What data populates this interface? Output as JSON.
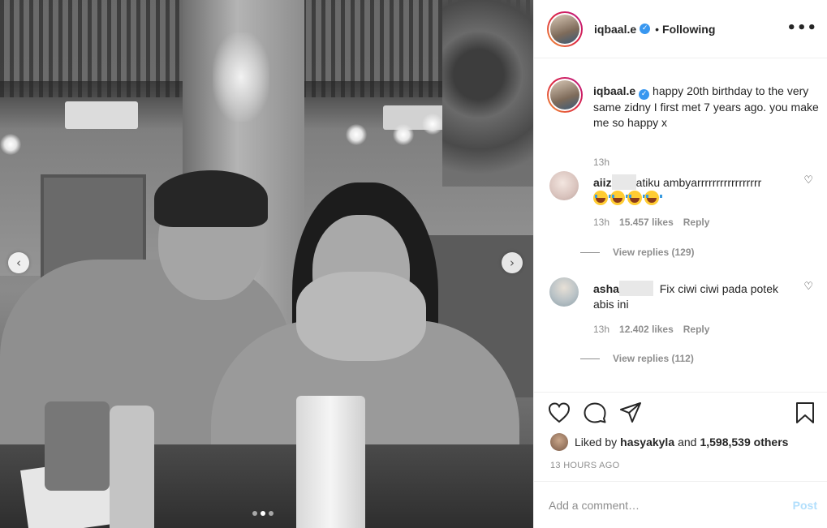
{
  "post": {
    "photo_alt": "",
    "nav_prev_glyph": "‹",
    "nav_next_glyph": "›",
    "carousel_dots": 3,
    "active_dot": 1
  },
  "header": {
    "username": "iqbaal.e",
    "verified_glyph": "✓",
    "separator": "•",
    "follow_status": "Following",
    "more_glyph": "•••"
  },
  "caption": {
    "username": "iqbaal.e",
    "text": "happy 20th birthday to the very same zidny I first met 7 years ago. you make me so happy x",
    "time": "13h"
  },
  "comments": [
    {
      "username_start": "aiiz",
      "text": "atiku ambyarrrrrrrrrrrrrrrrr",
      "emoji_count": 4,
      "time": "13h",
      "likes": "15.457 likes",
      "reply": "Reply",
      "view_replies": "View replies (129)"
    },
    {
      "username_start": "asha",
      "text": "Fix ciwi ciwi pada potek abis ini",
      "time": "13h",
      "likes": "12.402 likes",
      "reply": "Reply",
      "view_replies": "View replies (112)"
    }
  ],
  "actions": {
    "liked_prefix": "Liked by",
    "liked_user": "hasyakyla",
    "liked_and": "and",
    "liked_count": "1,598,539 others",
    "timestamp": "13 HOURS AGO"
  },
  "add_comment": {
    "placeholder": "Add a comment…",
    "post_label": "Post"
  },
  "colors": {
    "verified": "#3897f0",
    "post_disabled": "#b2dffc",
    "muted_text": "#8e8e8e"
  }
}
